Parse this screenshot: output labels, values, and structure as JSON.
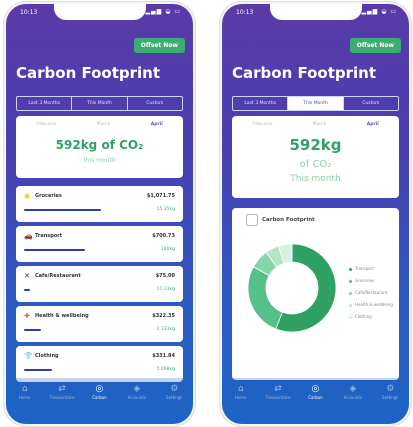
{
  "status": {
    "time": "10:13",
    "icons": "▂▄▆ ◒ ▭"
  },
  "offset_button": "Offset Now",
  "app_title": "Carbon Footprint",
  "tabs": [
    "Last 3 Months",
    "This Month",
    "Custom"
  ],
  "months": [
    "February",
    "March",
    "April"
  ],
  "left": {
    "total_value": "592kg of CO₂",
    "total_sub": "this month",
    "categories": [
      {
        "icon": "◉",
        "color": "#e8c42a",
        "name": "Groceries",
        "amount": "$1,071.75",
        "kg": "15.35kg",
        "level": 0.7
      },
      {
        "icon": "🚗",
        "color": "#3cae74",
        "name": "Transport",
        "amount": "$700.73",
        "kg": "180kg",
        "level": 0.55
      },
      {
        "icon": "✕",
        "color": "#333333",
        "name": "Cafe/Restaurant",
        "amount": "$75.00",
        "kg": "11.13kg",
        "level": 0.05
      },
      {
        "icon": "✚",
        "color": "#e05a4a",
        "name": "Health & wellbeing",
        "amount": "$322.35",
        "kg": "2.333kg",
        "level": 0.15
      },
      {
        "icon": "👕",
        "color": "#3b4fb8",
        "name": "Clothing",
        "amount": "$331.84",
        "kg": "5.098kg",
        "level": 0.25
      }
    ]
  },
  "right": {
    "total_value": "592kg",
    "total_sub1": "of CO₂",
    "total_sub2": "This month",
    "chart_title": "Carbon Footprint",
    "chart_data": {
      "type": "pie",
      "categories": [
        "Transport",
        "Groceries",
        "Cafe/Restaurant",
        "Health & wellbeing",
        "Clothing"
      ],
      "values": [
        56,
        27,
        7,
        5,
        5
      ],
      "colors": [
        "#2fa162",
        "#55c08a",
        "#86d4a9",
        "#b3e6c7",
        "#d6f2e0"
      ]
    }
  },
  "nav": [
    {
      "icon": "⌂",
      "label": "Home"
    },
    {
      "icon": "⇄",
      "label": "Transactions"
    },
    {
      "icon": "◎",
      "label": "Carbon"
    },
    {
      "icon": "◈",
      "label": "Accounts"
    },
    {
      "icon": "⚙",
      "label": "Settings"
    }
  ]
}
